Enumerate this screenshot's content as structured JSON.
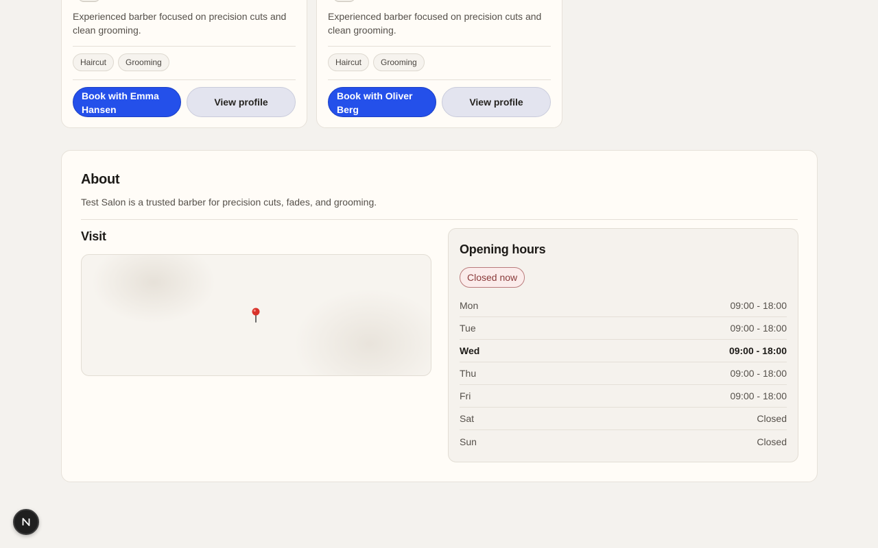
{
  "staff": [
    {
      "description": "Experienced barber focused on precision cuts and clean grooming.",
      "tags": [
        "Haircut",
        "Grooming"
      ],
      "book_label": "Book with Emma Hansen",
      "profile_label": "View profile"
    },
    {
      "description": "Experienced barber focused on precision cuts and clean grooming.",
      "tags": [
        "Haircut",
        "Grooming"
      ],
      "book_label": "Book with Oliver Berg",
      "profile_label": "View profile"
    }
  ],
  "about": {
    "title": "About",
    "text": "Test Salon is a trusted barber for precision cuts, fades, and grooming."
  },
  "visit": {
    "title": "Visit",
    "map_marker_icon": "map-pin-icon"
  },
  "opening_hours": {
    "title": "Opening hours",
    "status": "Closed now",
    "days": [
      {
        "day": "Mon",
        "hours": "09:00 - 18:00"
      },
      {
        "day": "Tue",
        "hours": "09:00 - 18:00"
      },
      {
        "day": "Wed",
        "hours": "09:00 - 18:00",
        "today": true
      },
      {
        "day": "Thu",
        "hours": "09:00 - 18:00"
      },
      {
        "day": "Fri",
        "hours": "09:00 - 18:00"
      },
      {
        "day": "Sat",
        "hours": "Closed"
      },
      {
        "day": "Sun",
        "hours": "Closed"
      }
    ]
  },
  "colors": {
    "accent": "#2450ea",
    "background": "#f4f2ee",
    "card": "#fffcf7",
    "status_closed": "#8a3a3a"
  },
  "dev_badge_icon": "nextjs-logo-icon"
}
